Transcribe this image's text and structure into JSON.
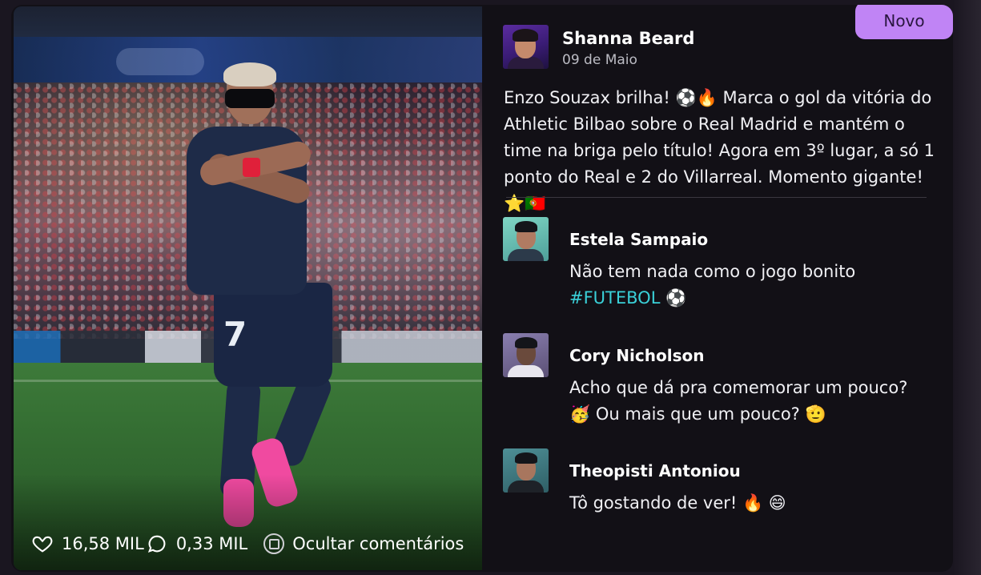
{
  "badge": {
    "label": "Novo"
  },
  "post": {
    "author": "Shanna Beard",
    "date": "09 de Maio",
    "text": "Enzo Souzax brilha! ⚽🔥 Marca o gol da vitória do Athletic Bilbao sobre o Real Madrid e mantém o time na briga pelo título! Agora em 3º lugar, a só 1 ponto do Real e 2 do Villarreal. Momento gigante! ⭐🇵🇹"
  },
  "stats": {
    "likes": "16,58 MIL",
    "comments": "0,33 MIL",
    "hide_comments_label": "Ocultar comentários"
  },
  "comments": [
    {
      "author": "Estela Sampaio",
      "text": "Não tem nada como o jogo bonito",
      "hashtag": "#FUTEBOL",
      "emoji": "⚽"
    },
    {
      "author": "Cory Nicholson",
      "text": "Acho que dá pra comemorar um pouco? 🥳 Ou mais que um pouco? 🫡"
    },
    {
      "author": "Theopisti Antoniou",
      "text": "Tô gostando de ver! 🔥 😄"
    }
  ],
  "icons": {
    "like": "heart-icon",
    "comment": "speech-bubble-icon",
    "hide": "hide-comments-icon"
  },
  "colors": {
    "badge": "#c084f5",
    "hashtag": "#3ad0d8",
    "panel": "#121016"
  }
}
